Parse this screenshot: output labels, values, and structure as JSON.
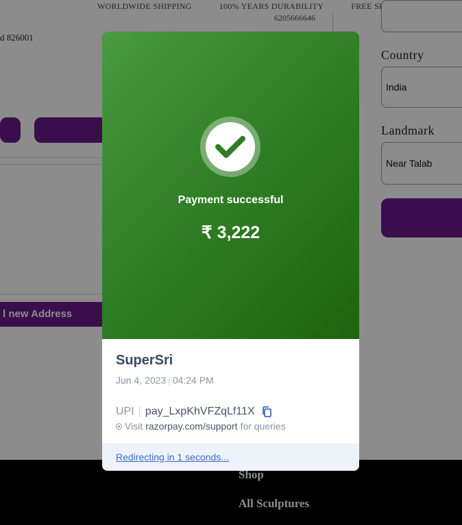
{
  "background": {
    "topbar": [
      "WORLDWIDE SHIPPING",
      "100% YEARS DURABILITY",
      "FREE SHIPPING"
    ],
    "phone": "6205666646",
    "address_fragment": "d 826001",
    "add_address_label": "l new Address",
    "fields": {
      "country": {
        "label": "Country",
        "value": "India"
      },
      "landmark": {
        "label": "Landmark",
        "value": "Near Talab"
      }
    },
    "footer": {
      "shop": "Shop",
      "sculptures": "All Sculptures"
    },
    "colors": {
      "accent": "#6a1b8a"
    }
  },
  "payment": {
    "status": "Payment successful",
    "amount": "₹ 3,222",
    "merchant": "SuperSri",
    "date": "Jun 4, 2023",
    "time": "04:24 PM",
    "method": "UPI",
    "payment_id": "pay_LxpKhVFZqLf11X",
    "visit_prefix": "Visit",
    "support_link": "razorpay.com/support",
    "visit_suffix": "for queries",
    "redirect": "Redirecting in 1 seconds...",
    "icons": [
      "check-icon",
      "copy-icon",
      "info-icon"
    ],
    "colors": {
      "success": "#2f7d24",
      "link": "#3a6bc9"
    }
  }
}
